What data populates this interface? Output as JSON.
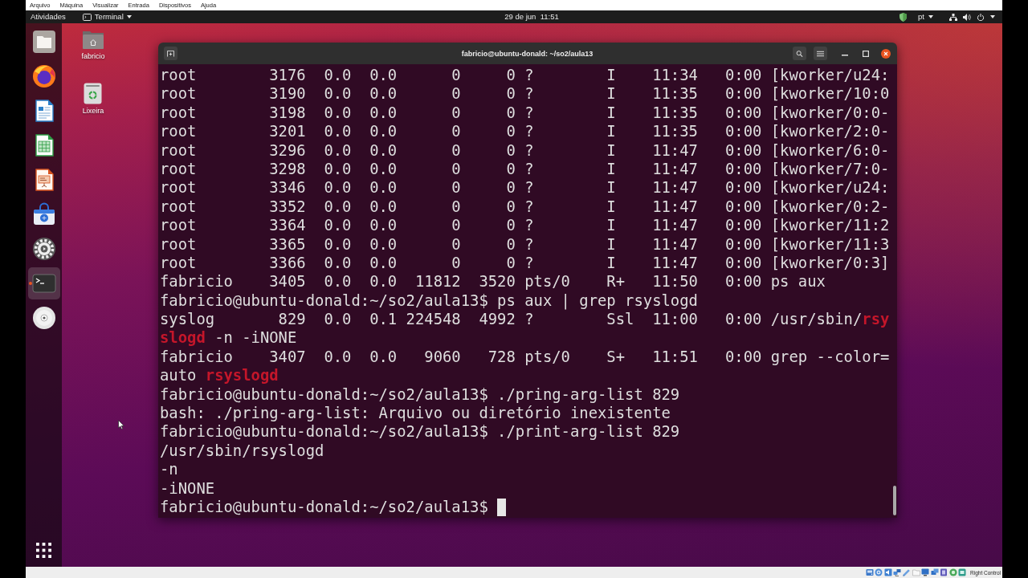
{
  "vm_menu": [
    "Arquivo",
    "Máquina",
    "Visualizar",
    "Entrada",
    "Dispositivos",
    "Ajuda"
  ],
  "top_bar": {
    "activities": "Atividades",
    "app_menu": "Terminal",
    "clock": "29 de jun  11:51",
    "keyboard_layout": "pt"
  },
  "dock": {
    "items": [
      {
        "kind": "files",
        "selected": false,
        "running": false
      },
      {
        "kind": "browser",
        "selected": false,
        "running": false
      },
      {
        "kind": "document",
        "selected": false,
        "running": false
      },
      {
        "kind": "spreadsheet",
        "selected": false,
        "running": false
      },
      {
        "kind": "presentation",
        "selected": false,
        "running": false
      },
      {
        "kind": "store",
        "selected": false,
        "running": false
      },
      {
        "kind": "settings",
        "selected": false,
        "running": false
      },
      {
        "kind": "terminal",
        "selected": true,
        "running": true
      },
      {
        "kind": "disc",
        "selected": false,
        "running": false
      }
    ]
  },
  "desktop_icons": [
    {
      "kind": "home",
      "label": "fabricio"
    },
    {
      "kind": "trash",
      "label": "Lixeira"
    }
  ],
  "terminal": {
    "title": "fabricio@ubuntu-donald: ~/so2/aula13",
    "lines": [
      "root        3176  0.0  0.0      0     0 ?        I    11:34   0:00 [kworker/u24:",
      "root        3190  0.0  0.0      0     0 ?        I    11:35   0:00 [kworker/10:0",
      "root        3198  0.0  0.0      0     0 ?        I    11:35   0:00 [kworker/0:0-",
      "root        3201  0.0  0.0      0     0 ?        I    11:35   0:00 [kworker/2:0-",
      "root        3296  0.0  0.0      0     0 ?        I    11:47   0:00 [kworker/6:0-",
      "root        3298  0.0  0.0      0     0 ?        I    11:47   0:00 [kworker/7:0-",
      "root        3346  0.0  0.0      0     0 ?        I    11:47   0:00 [kworker/u24:",
      "root        3352  0.0  0.0      0     0 ?        I    11:47   0:00 [kworker/0:2-",
      "root        3364  0.0  0.0      0     0 ?        I    11:47   0:00 [kworker/11:2",
      "root        3365  0.0  0.0      0     0 ?        I    11:47   0:00 [kworker/11:3",
      "root        3366  0.0  0.0      0     0 ?        I    11:47   0:00 [kworker/0:3]",
      "fabricio    3405  0.0  0.0  11812  3520 pts/0    R+   11:50   0:00 ps aux",
      "fabricio@ubuntu-donald:~/so2/aula13$ ps aux | grep rsyslogd",
      "syslog       829  0.0  0.1 224548  4992 ?        Ssl  11:00   0:00 /usr/sbin/**rsy**",
      "**slogd** -n -iNONE",
      "fabricio    3407  0.0  0.0   9060   728 pts/0    S+   11:51   0:00 grep --color=",
      "auto **rsyslogd**",
      "fabricio@ubuntu-donald:~/so2/aula13$ ./pring-arg-list 829",
      "bash: ./pring-arg-list: Arquivo ou diretório inexistente",
      "fabricio@ubuntu-donald:~/so2/aula13$ ./print-arg-list 829",
      "/usr/sbin/rsyslogd",
      "-n",
      "-iNONE",
      "fabricio@ubuntu-donald:~/so2/aula13$"
    ],
    "cursor": true
  },
  "status_bar": {
    "host_key": "Right Control"
  }
}
